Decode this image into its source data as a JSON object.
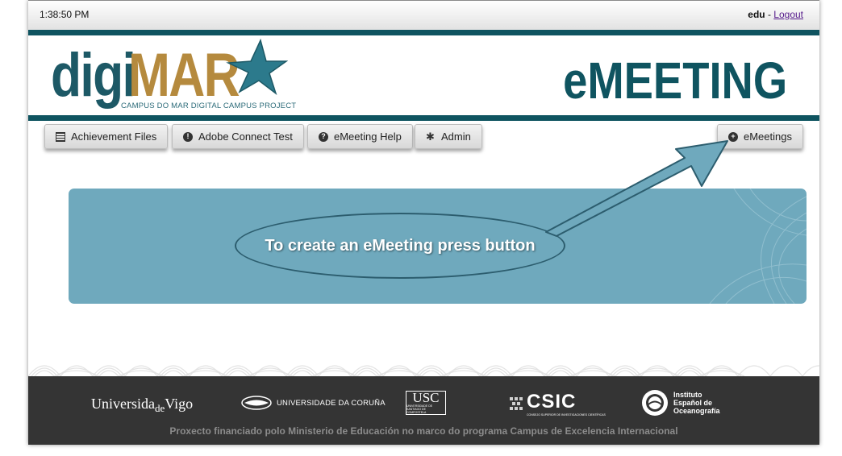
{
  "topbar": {
    "time": "1:38:50 PM",
    "username": "edu",
    "separator": " - ",
    "logout_label": "Logout"
  },
  "header": {
    "logo_digi": "digi",
    "logo_mar": "MAR",
    "logo_subtitle": "CAMPUS DO MAR DIGITAL CAMPUS PROJECT",
    "brand_title": "eMEETING"
  },
  "nav": {
    "items": [
      {
        "label": "Achievement Files",
        "icon": "list-icon"
      },
      {
        "label": "Adobe Connect Test",
        "icon": "exclamation-icon"
      },
      {
        "label": "eMeeting Help",
        "icon": "question-icon"
      },
      {
        "label": "Admin",
        "icon": "gear-icon"
      }
    ],
    "emeetings": {
      "label": "eMeetings",
      "icon": "plus-circle-icon"
    }
  },
  "callout": {
    "text": "To create an eMeeting press button"
  },
  "footer": {
    "uvigo_a": "Universida",
    "uvigo_b": "de",
    "uvigo_c": "Vigo",
    "udc": "UNIVERSIDADE DA CORUÑA",
    "usc": "USC",
    "usc_small": "UNIVERSIDADE DE SANTIAGO DE COMPOSTELA",
    "csic": "CSIC",
    "csic_small": "CONSEJO SUPERIOR DE INVESTIGACIONES CIENTÍFICAS",
    "ieo_1": "Instituto",
    "ieo_2": "Español de",
    "ieo_3": "Oceanografía",
    "funding_text": "Proxecto financiado polo Ministerio de Educación no marco do programa Campus de Excelencia Internacional"
  },
  "colors": {
    "brand_teal": "#0f5460",
    "logo_gold": "#b58a3e",
    "panel_blue": "#6fa9bd",
    "footer_dark": "#343434"
  }
}
